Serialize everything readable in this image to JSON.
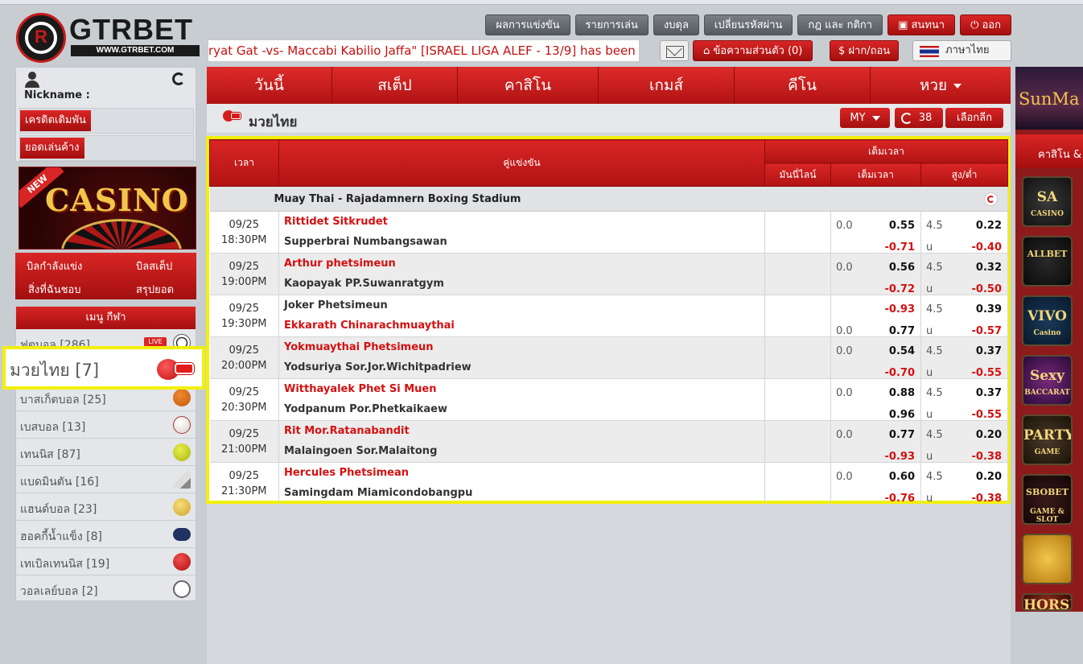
{
  "header": {
    "logo_text": "GTRBET",
    "logo_url": "WWW.GTRBET.COM",
    "top_buttons": [
      "ผลการแข่งขัน",
      "รายการเล่น",
      "งบดุล",
      "เปลี่ยนรหัสผ่าน",
      "กฎ และ กติกา"
    ],
    "chat_label": "สนทนา",
    "logout_label": "ออก",
    "ticker_text": "ryat Gat -vs- Maccabi Kabilio Jaffa\" [ISRAEL LIGA ALEF - 13/9] has been po",
    "messages_label": "ข้อความส่วนตัว (0)",
    "deposit_label": "ฝาก/ถอน",
    "language_label": "ภาษาไทย"
  },
  "user": {
    "nickname_label": "Nickname :",
    "credit_label": "เครดิตเดิมพัน",
    "outstanding_label": "ยอดเล่นค้าง"
  },
  "banner": {
    "new_tag": "NEW",
    "text": "CASINO"
  },
  "quick_links": [
    "บิลกำลังแข่ง",
    "บิลสเต็ป",
    "สิ่งที่ฉันชอบ",
    "สรุปยอด"
  ],
  "sport_menu": {
    "title": "เมนู กีฬา",
    "live_badge": "LIVE",
    "items": [
      {
        "label": "ฟุตบอล [286]",
        "icon": "soccer-ball-icon"
      },
      {
        "label": "มวยไทย [7]",
        "icon": "boxing-glove-icon"
      },
      {
        "label": "บาสเก็ตบอล [25]",
        "icon": "basketball-icon"
      },
      {
        "label": "เบสบอล [13]",
        "icon": "baseball-icon"
      },
      {
        "label": "เทนนิส [87]",
        "icon": "tennis-ball-icon"
      },
      {
        "label": "แบดมินตัน [16]",
        "icon": "shuttlecock-icon"
      },
      {
        "label": "แฮนด์บอล [23]",
        "icon": "handball-icon"
      },
      {
        "label": "ฮอคกี้น้ำแข็ง [8]",
        "icon": "hockey-icon"
      },
      {
        "label": "เทเบิลเทนนิส [19]",
        "icon": "table-tennis-icon"
      },
      {
        "label": "วอลเลย์บอล [2]",
        "icon": "volleyball-icon"
      }
    ]
  },
  "nav": {
    "tabs": [
      "วันนี้",
      "สเต็ป",
      "คาสิโน",
      "เกมส์",
      "คีโน",
      "หวย"
    ]
  },
  "section": {
    "title": "มวยไทย",
    "odds_format": "MY",
    "refresh_count": "38",
    "select_league_label": "เลือกลีก"
  },
  "table": {
    "headers": {
      "time": "เวลา",
      "match": "คู่แข่งขัน",
      "fulltime": "เต็มเวลา",
      "moneyline": "มันนี่ไลน์",
      "handicap": "เต็มเวลา",
      "overunder": "สูง/ต่ำ"
    },
    "league": "Muay Thai - Rajadamnern Boxing Stadium",
    "matches": [
      {
        "date": "09/25",
        "time": "18:30PM",
        "home": "Rittidet Sitkrudet",
        "away": "Supperbrai Numbangsawan",
        "fav": "home",
        "hdp_line": "0.0",
        "hdp_home": "0.55",
        "hdp_away": "-0.71",
        "ou_line": "4.5",
        "ou_u": "u",
        "ou_over": "0.22",
        "ou_under": "-0.40"
      },
      {
        "date": "09/25",
        "time": "19:00PM",
        "home": "Arthur phetsimeun",
        "away": "Kaopayak PP.Suwanratgym",
        "fav": "home",
        "hdp_line": "0.0",
        "hdp_home": "0.56",
        "hdp_away": "-0.72",
        "ou_line": "4.5",
        "ou_u": "u",
        "ou_over": "0.32",
        "ou_under": "-0.50"
      },
      {
        "date": "09/25",
        "time": "19:30PM",
        "home": "Joker Phetsimeun",
        "away": "Ekkarath Chinarachmuaythai",
        "fav": "away",
        "hdp_line": "0.0",
        "hdp_home": "-0.93",
        "hdp_away": "0.77",
        "ou_line": "4.5",
        "ou_u": "u",
        "ou_over": "0.39",
        "ou_under": "-0.57"
      },
      {
        "date": "09/25",
        "time": "20:00PM",
        "home": "Yokmuaythai Phetsimeun",
        "away": "Yodsuriya Sor.Jor.Wichitpadriew",
        "fav": "home",
        "hdp_line": "0.0",
        "hdp_home": "0.54",
        "hdp_away": "-0.70",
        "ou_line": "4.5",
        "ou_u": "u",
        "ou_over": "0.37",
        "ou_under": "-0.55"
      },
      {
        "date": "09/25",
        "time": "20:30PM",
        "home": "Witthayalek Phet Si Muen",
        "away": "Yodpanum Por.Phetkaikaew",
        "fav": "home",
        "hdp_line": "0.0",
        "hdp_home": "0.88",
        "hdp_away": "0.96",
        "ou_line": "4.5",
        "ou_u": "u",
        "ou_over": "0.37",
        "ou_under": "-0.55"
      },
      {
        "date": "09/25",
        "time": "21:00PM",
        "home": "Rit Mor.Ratanabandit",
        "away": "Malaingoen Sor.Malaitong",
        "fav": "home",
        "hdp_line": "0.0",
        "hdp_home": "0.77",
        "hdp_away": "-0.93",
        "ou_line": "4.5",
        "ou_u": "u",
        "ou_over": "0.20",
        "ou_under": "-0.38"
      },
      {
        "date": "09/25",
        "time": "21:30PM",
        "home": "Hercules Phetsimean",
        "away": "Samingdam Miamicondobangpu",
        "fav": "home",
        "hdp_line": "0.0",
        "hdp_home": "0.60",
        "hdp_away": "-0.76",
        "ou_line": "4.5",
        "ou_u": "u",
        "ou_over": "0.20",
        "ou_under": "-0.38"
      }
    ]
  },
  "right_panel": {
    "banner_text": "SunMa",
    "title": "คาสิโน &",
    "tiles": [
      {
        "name": "sa-casino",
        "label": "SA",
        "sub": "CASINO"
      },
      {
        "name": "allbet",
        "label": "ALLBET",
        "sub": ""
      },
      {
        "name": "vivo-casino",
        "label": "VIVO",
        "sub": "Casino"
      },
      {
        "name": "sexy-baccarat",
        "label": "Sexy",
        "sub": "BACCARAT"
      },
      {
        "name": "party-game",
        "label": "PARTY",
        "sub": "GAME"
      },
      {
        "name": "sbobet-game",
        "label": "SBOBET",
        "sub": "GAME & SLOT"
      },
      {
        "name": "cockfight",
        "label": "",
        "sub": ""
      },
      {
        "name": "horse",
        "label": "HORSE",
        "sub": ""
      }
    ]
  },
  "colors": {
    "accent": "#c41010",
    "highlight": "#f2f00c"
  }
}
